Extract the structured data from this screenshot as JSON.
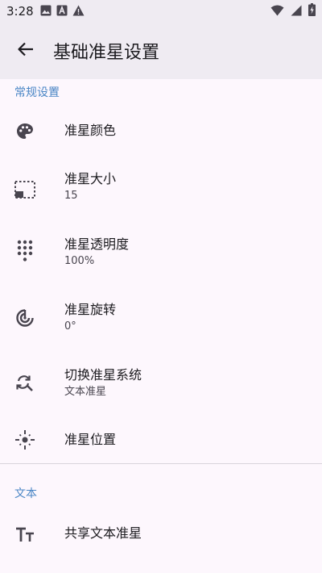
{
  "status_bar": {
    "time": "3:28",
    "left_icons": [
      "image-icon",
      "a-badge-icon",
      "warning-icon"
    ],
    "right_icons": [
      "wifi-icon",
      "signal-icon",
      "battery-charging-icon"
    ]
  },
  "appbar": {
    "title": "基础准星设置",
    "back_icon": "arrow-back-icon"
  },
  "sections": {
    "general": {
      "header": "常规设置"
    },
    "text": {
      "header": "文本"
    }
  },
  "items": {
    "color": {
      "title": "准星颜色",
      "icon": "palette-icon"
    },
    "size": {
      "title": "准星大小",
      "value": "15",
      "icon": "picture-in-picture-icon"
    },
    "opacity": {
      "title": "准星透明度",
      "value": "100%",
      "icon": "dialpad-icon"
    },
    "rotation": {
      "title": "准星旋转",
      "value": "0°",
      "icon": "rotation-icon"
    },
    "system": {
      "title": "切换准星系统",
      "value": "文本准星",
      "icon": "find-replace-icon"
    },
    "position": {
      "title": "准星位置",
      "icon": "gps-fixed-icon"
    },
    "share": {
      "title": "共享文本准星",
      "icon": "text-fields-icon"
    }
  },
  "colors": {
    "accent": "#4a86c5",
    "appbar_bg": "#efebf2",
    "page_bg": "#fdf7fd",
    "icon": "#49454f"
  }
}
